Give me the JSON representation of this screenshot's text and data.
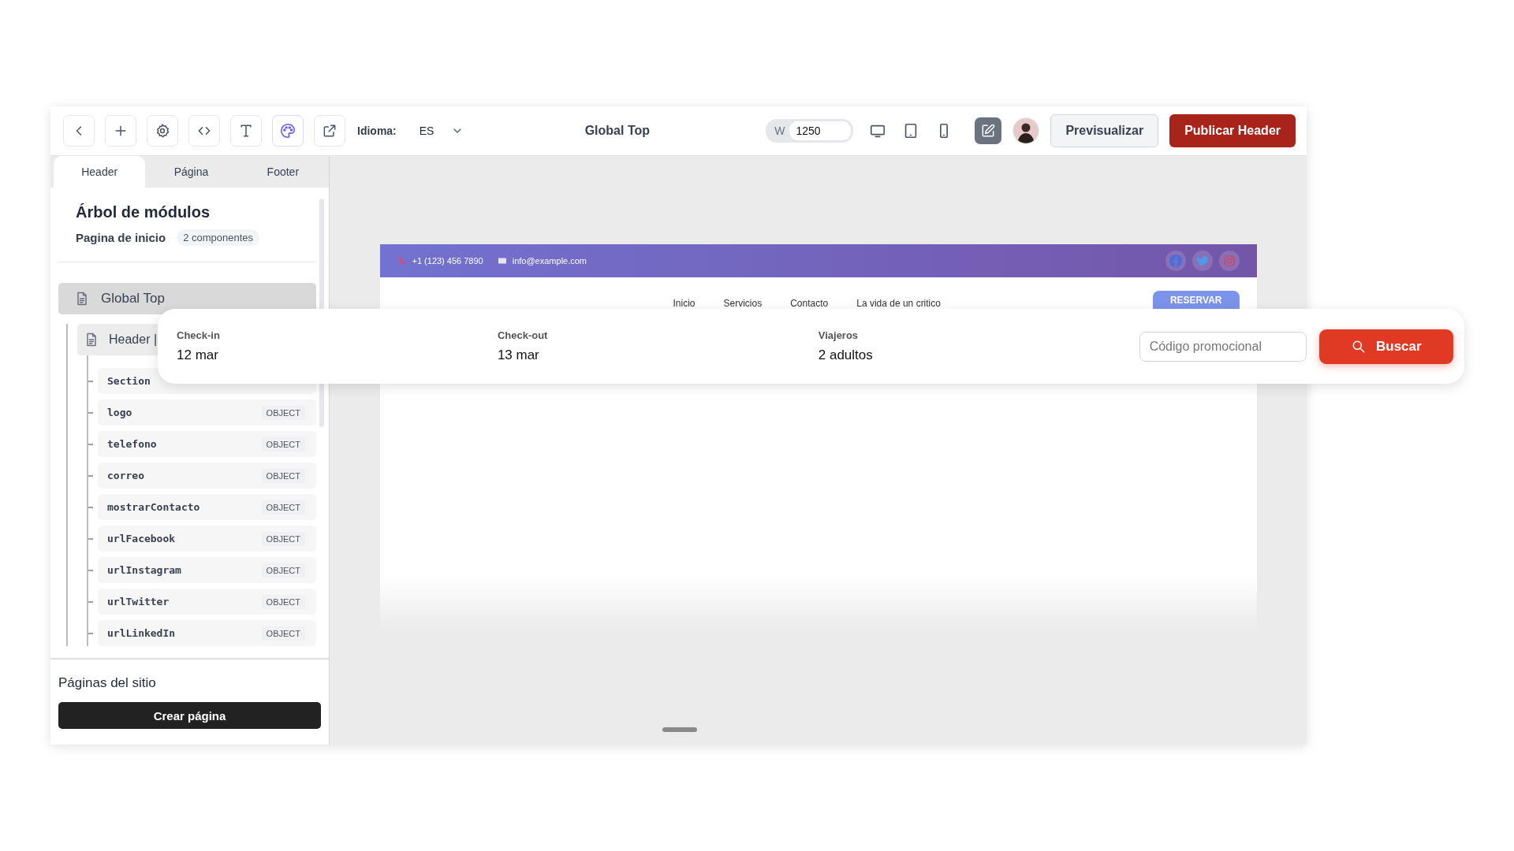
{
  "toolbar": {
    "tools": [
      {
        "kind": "back",
        "selected": false
      },
      {
        "kind": "add",
        "selected": false
      },
      {
        "kind": "settings",
        "selected": false
      },
      {
        "kind": "code",
        "selected": false
      },
      {
        "kind": "text",
        "selected": false
      },
      {
        "kind": "palette",
        "selected": true
      },
      {
        "kind": "external",
        "selected": false
      }
    ],
    "language": {
      "label": "Idioma:",
      "value": "ES"
    },
    "title": "Global Top",
    "width": {
      "label": "W",
      "value": "1250"
    },
    "devices": [
      {
        "kind": "desktop"
      },
      {
        "kind": "tablet"
      },
      {
        "kind": "mobile"
      }
    ],
    "edit_toggle": {
      "on": true
    },
    "preview_button": "Previsualizar",
    "publish_button": "Publicar Header"
  },
  "sidebar": {
    "tabs": [
      {
        "label": "Header",
        "selected": true
      },
      {
        "label": "Página",
        "selected": false
      },
      {
        "label": "Footer",
        "selected": false
      }
    ],
    "title": "Árbol de módulos",
    "subtitle": "Pagina de inicio",
    "count_badge": "2 componentes",
    "tree": [
      {
        "kind": "module",
        "label": "Global Top",
        "selected": true,
        "children": [
          {
            "kind": "module",
            "label": "Header |",
            "selected": false,
            "children": [
              {
                "kind": "field",
                "label": "Section",
                "selected": false
              },
              {
                "kind": "field",
                "label": "logo",
                "type": "OBJECT",
                "selected": false
              },
              {
                "kind": "field",
                "label": "telefono",
                "type": "OBJECT",
                "selected": false
              },
              {
                "kind": "field",
                "label": "correo",
                "type": "OBJECT",
                "selected": false
              },
              {
                "kind": "field",
                "label": "mostrarContacto",
                "type": "OBJECT",
                "selected": false
              },
              {
                "kind": "field",
                "label": "urlFacebook",
                "type": "OBJECT",
                "selected": false
              },
              {
                "kind": "field",
                "label": "urlInstagram",
                "type": "OBJECT",
                "selected": false
              },
              {
                "kind": "field",
                "label": "urlTwitter",
                "type": "OBJECT",
                "selected": false
              },
              {
                "kind": "field",
                "label": "urlLinkedIn",
                "type": "OBJECT",
                "selected": false
              }
            ]
          }
        ]
      }
    ],
    "pages_title": "Páginas del sitio",
    "create_button": "Crear página"
  },
  "site_preview": {
    "phone": "+1 (123) 456 7890",
    "email": "info@example.com",
    "socials": [
      {
        "kind": "facebook"
      },
      {
        "kind": "twitter"
      },
      {
        "kind": "instagram"
      }
    ],
    "nav": [
      "Inicio",
      "Servicios",
      "Contacto",
      "La vida de un critico"
    ],
    "cta_button": "RESERVAR"
  },
  "booking_bar": {
    "fields": [
      {
        "label": "Check-in",
        "value": "12 mar"
      },
      {
        "label": "Check-out",
        "value": "13 mar"
      },
      {
        "label": "Viajeros",
        "value": "2 adultos"
      }
    ],
    "promo": {
      "placeholder": "Código promocional"
    },
    "search_button": "Buscar"
  }
}
